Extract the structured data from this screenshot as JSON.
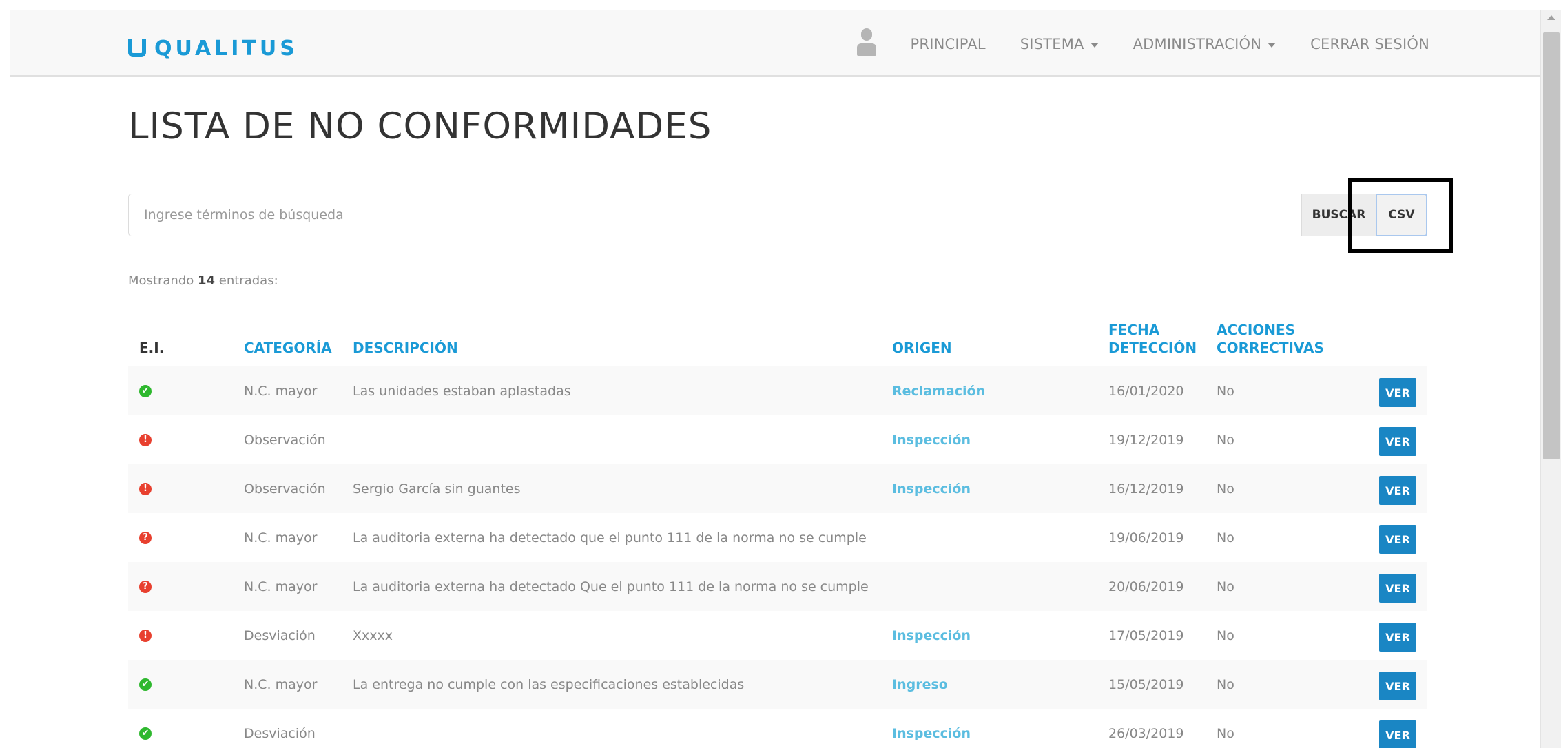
{
  "navbar": {
    "brand": "QUALITUS",
    "links": [
      "PRINCIPAL",
      "SISTEMA",
      "ADMINISTRACIÓN",
      "CERRAR SESIÓN"
    ]
  },
  "page": {
    "title": "LISTA DE NO CONFORMIDADES"
  },
  "search": {
    "placeholder": "Ingrese términos de búsqueda",
    "value": "",
    "buscar_label": "BUSCAR",
    "csv_label": "CSV"
  },
  "count": {
    "prefix": "Mostrando ",
    "number": "14",
    "suffix": " entradas:"
  },
  "table": {
    "headers": {
      "ei": "E.I.",
      "categoria": "CATEGORÍA",
      "descripcion": "DESCRIPCIÓN",
      "origen": "ORIGEN",
      "fecha_1": "FECHA",
      "fecha_2": "DETECCIÓN",
      "acciones_1": "ACCIONES",
      "acciones_2": "CORRECTIVAS"
    },
    "ver_label": "VER",
    "rows": [
      {
        "status": "ok",
        "categoria": "N.C. mayor",
        "descripcion": "Las unidades estaban aplastadas",
        "origen": "Reclamación",
        "fecha": "16/01/2020",
        "acciones": "No"
      },
      {
        "status": "warn",
        "categoria": "Observación",
        "descripcion": "",
        "origen": "Inspección",
        "fecha": "19/12/2019",
        "acciones": "No"
      },
      {
        "status": "warn",
        "categoria": "Observación",
        "descripcion": "Sergio García sin guantes",
        "origen": "Inspección",
        "fecha": "16/12/2019",
        "acciones": "No"
      },
      {
        "status": "question",
        "categoria": "N.C. mayor",
        "descripcion": "La auditoria externa ha detectado que el punto 111 de la norma no se cumple",
        "origen": "",
        "fecha": "19/06/2019",
        "acciones": "No"
      },
      {
        "status": "question",
        "categoria": "N.C. mayor",
        "descripcion": "La auditoria externa ha detectado Que el punto 111 de la norma no se cumple",
        "origen": "",
        "fecha": "20/06/2019",
        "acciones": "No"
      },
      {
        "status": "warn",
        "categoria": "Desviación",
        "descripcion": "Xxxxx",
        "origen": "Inspección",
        "fecha": "17/05/2019",
        "acciones": "No"
      },
      {
        "status": "ok",
        "categoria": "N.C. mayor",
        "descripcion": "La entrega no cumple con las especificaciones establecidas",
        "origen": "Ingreso",
        "fecha": "15/05/2019",
        "acciones": "No"
      },
      {
        "status": "ok",
        "categoria": "Desviación",
        "descripcion": "",
        "origen": "Inspección",
        "fecha": "26/03/2019",
        "acciones": "No"
      }
    ]
  },
  "colors": {
    "accent": "#1a9ad6",
    "ok": "#2eb82e",
    "warn": "#e8402f",
    "button": "#1a86c4"
  },
  "icons": {
    "brand": "qualitus-logo-icon",
    "user": "user-icon",
    "ok": "check-circle-icon",
    "warn": "exclamation-circle-icon",
    "question": "question-circle-icon"
  }
}
